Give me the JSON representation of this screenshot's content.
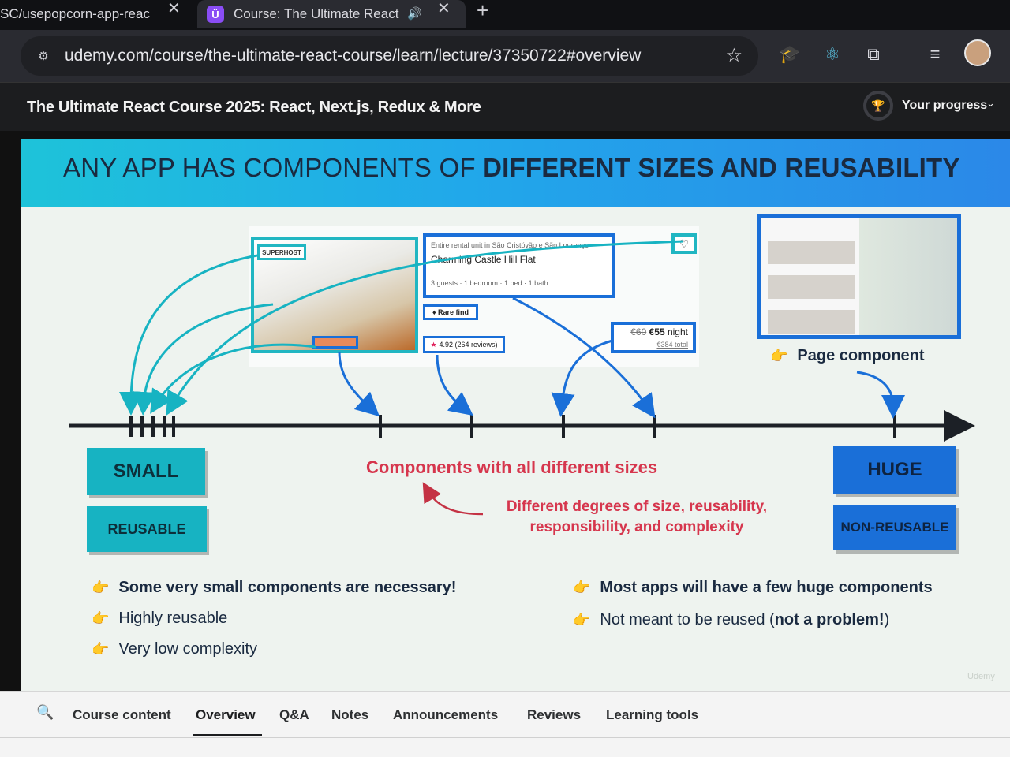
{
  "browser": {
    "tabs": [
      {
        "title": "SC/usepopcorn-app-reac",
        "active": false
      },
      {
        "title": "Course: The Ultimate React",
        "active": true
      }
    ],
    "close_glyph": "✕",
    "new_tab_glyph": "+",
    "url": "udemy.com/course/the-ultimate-react-course/learn/lecture/37350722#overview",
    "icons": [
      "site-settings-icon",
      "bookmark-star-icon",
      "extension-icon",
      "react-devtools-icon",
      "puzzle-icon",
      "reading-list-icon",
      "profile-avatar"
    ]
  },
  "course_header": {
    "title": "The Ultimate React Course 2025: React, Next.js, Redux & More",
    "progress_label": "Your progress"
  },
  "slide": {
    "heading_normal": "ANY APP HAS COMPONENTS OF ",
    "heading_bold": "DIFFERENT SIZES AND REUSABILITY",
    "card": {
      "badge": "SUPERHOST",
      "subtitle": "Entire rental unit in São Cristóvão e São Lourenço",
      "title": "Charming Castle Hill Flat",
      "details": "3 guests · 1 bedroom · 1 bed · 1 bath",
      "rare_find": "Rare find",
      "rating": "4.92 (264 reviews)",
      "price_old": "€60",
      "price_new": "€55",
      "price_unit": "night",
      "price_total": "€384 total"
    },
    "page_component_label": "Page component",
    "small_label": "SMALL",
    "reusable_label": "REUSABLE",
    "huge_label": "HUGE",
    "nonreusable_label": "NON-REUSABLE",
    "center_label": "Components with all different sizes",
    "center_sub": "Different degrees of size, reusability, responsibility, and complexity",
    "bullets_left": [
      "Some very small components are necessary!",
      "Highly reusable",
      "Very low complexity"
    ],
    "bullets_right_1": "Most apps will have a few huge components",
    "bullets_right_2_normal": "Not meant to be reused (",
    "bullets_right_2_bold": "not a problem!",
    "bullets_right_2_end": ")",
    "watermark": "Udemy",
    "colors": {
      "teal": "#17b3c2",
      "blue": "#1a6fd8",
      "red": "#d6364d",
      "banner_start": "#1ec3d9",
      "banner_end": "#2b88e8"
    }
  },
  "lecture_tabs": [
    "Course content",
    "Overview",
    "Q&A",
    "Notes",
    "Announcements",
    "Reviews",
    "Learning tools"
  ],
  "active_tab": "Overview"
}
